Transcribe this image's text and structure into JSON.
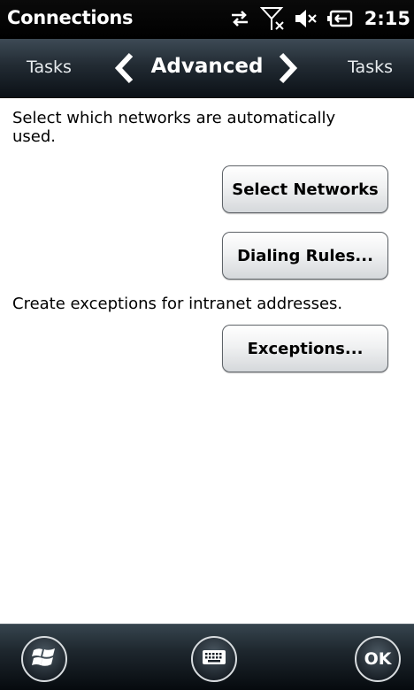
{
  "status_bar": {
    "app_title": "Connections",
    "time": "2:15",
    "icons": [
      "data-sync-icon",
      "no-signal-icon",
      "speaker-muted-icon",
      "battery-charging-icon"
    ]
  },
  "tab_bar": {
    "previous_tab": "Tasks",
    "current_tab": "Advanced",
    "next_tab": "Tasks"
  },
  "content": {
    "networks_description": "Select which networks are automatically used.",
    "select_networks_label": "Select Networks",
    "dialing_rules_label": "Dialing Rules...",
    "exceptions_description": "Create exceptions for intranet addresses.",
    "exceptions_label": "Exceptions..."
  },
  "bottom_bar": {
    "ok_label": "OK",
    "icons": [
      "windows-start-icon",
      "keyboard-icon"
    ]
  },
  "colors": {
    "header_bg": "#000000",
    "tabbar_bg": "#2b353e",
    "content_bg": "#ffffff"
  }
}
